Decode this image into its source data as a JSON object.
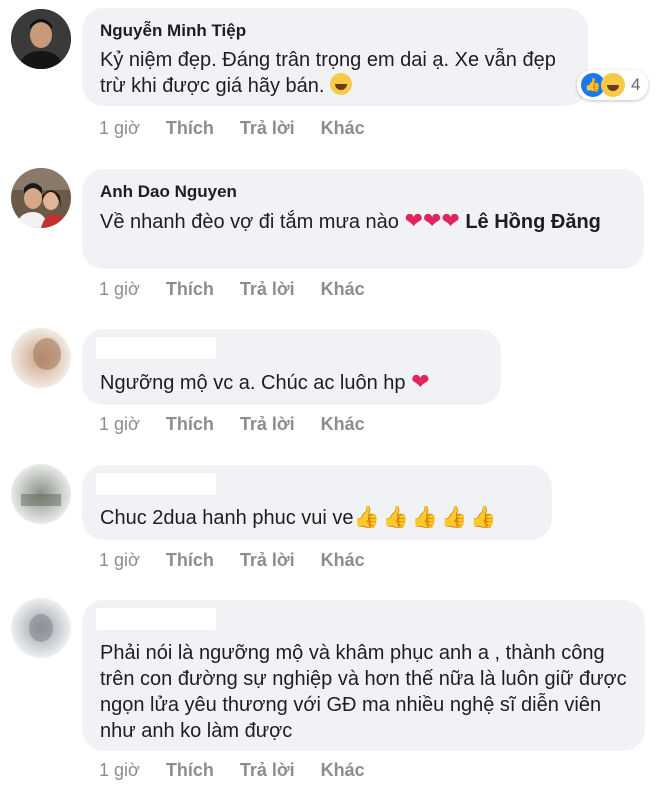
{
  "comments": [
    {
      "name": "Nguyễn Minh Tiệp",
      "text": "Kỷ niệm đẹp. Đáng trân trọng em dai ạ. Xe vẫn đẹp trừ khi được giá hãy bán.",
      "emoji": "laughing-with-tears",
      "reaction_count": "4",
      "reactions": [
        "like",
        "haha"
      ],
      "time": "1 giờ",
      "like": "Thích",
      "reply": "Trả lời",
      "more": "Khác"
    },
    {
      "name": "Anh Dao Nguyen",
      "text": "Về nhanh đèo vợ đi tắm mưa nào",
      "hearts": "❤❤❤",
      "mention": "Lê Hồng Đăng",
      "time": "1 giờ",
      "like": "Thích",
      "reply": "Trả lời",
      "more": "Khác"
    },
    {
      "name": "",
      "text": "Ngưỡng mộ vc a. Chúc ac luôn hp",
      "hearts": "❤",
      "time": "1 giờ",
      "like": "Thích",
      "reply": "Trả lời",
      "more": "Khác"
    },
    {
      "name": "",
      "text": "Chuc 2dua hanh phuc vui ve",
      "thumbs": "👍👍👍👍👍",
      "time": "1 giờ",
      "like": "Thích",
      "reply": "Trả lời",
      "more": "Khác"
    },
    {
      "name": "",
      "text": "Phải nói là ngưỡng mộ và khâm phục anh a , thành công trên con đường sự nghiệp và hơn thế nữa là luôn giữ được ngọn lửa yêu thương với GĐ ma nhiều nghệ sĩ diễn viên như anh ko làm được",
      "time": "1 giờ",
      "like": "Thích",
      "reply": "Trả lời",
      "more": "Khác"
    }
  ],
  "colors": {
    "bubble": "#f0f2f5",
    "muted": "#8a8d91",
    "heart": "#e0245e",
    "like_blue": "#1877f2"
  }
}
